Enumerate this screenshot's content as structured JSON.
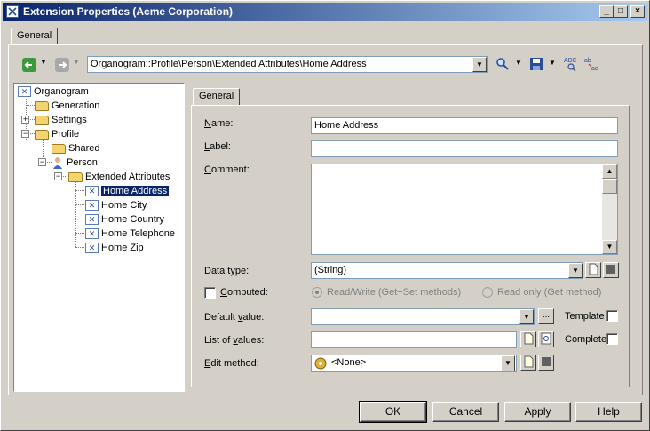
{
  "window": {
    "title": "Extension Properties (Acme Corporation)",
    "minimize": "_",
    "maximize": "□",
    "close": "×"
  },
  "outer_tab": "General",
  "toolbar": {
    "path": "Organogram::Profile\\Person\\Extended Attributes\\Home Address"
  },
  "tree": {
    "root": "Organogram",
    "items": [
      {
        "label": "Generation"
      },
      {
        "label": "Settings"
      },
      {
        "label": "Profile"
      },
      {
        "label": "Shared"
      },
      {
        "label": "Person"
      },
      {
        "label": "Extended Attributes"
      },
      {
        "label": "Home Address"
      },
      {
        "label": "Home City"
      },
      {
        "label": "Home Country"
      },
      {
        "label": "Home Telephone"
      },
      {
        "label": "Home Zip"
      }
    ]
  },
  "inner_tab": "General",
  "form": {
    "name_label_u": "N",
    "name_label_rest": "ame:",
    "name_value": "Home Address",
    "label_label_u": "L",
    "label_label_rest": "abel:",
    "label_value": "",
    "comment_label_u": "C",
    "comment_label_rest": "omment:",
    "comment_value": "",
    "datatype_label": "Data type:",
    "datatype_value": "(String)",
    "computed_label_u": "C",
    "computed_label_rest": "omputed:",
    "rw_label": "Read/Write (Get+Set methods)",
    "ro_label": "Read only (Get method)",
    "default_label_pre": "Default ",
    "default_label_u": "v",
    "default_label_rest": "alue:",
    "default_value": "",
    "template_label": "Template",
    "list_label_pre": "List of ",
    "list_label_u": "v",
    "list_label_rest": "alues:",
    "list_value": "",
    "complete_label": "Complete",
    "edit_label_u": "E",
    "edit_label_rest": "dit method:",
    "edit_value": "<None>",
    "ellipsis": "..."
  },
  "buttons": {
    "ok": "OK",
    "cancel": "Cancel",
    "apply": "Apply",
    "help": "Help"
  }
}
